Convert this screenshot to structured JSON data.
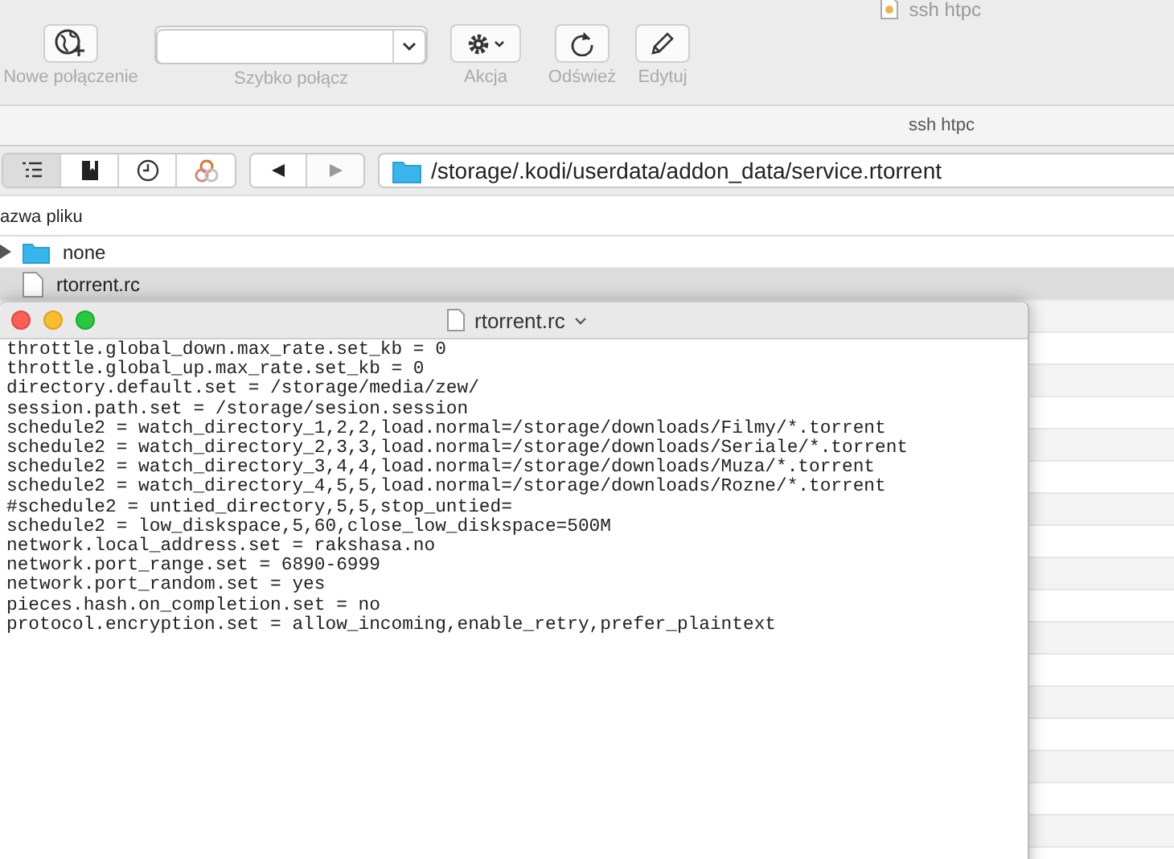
{
  "window": {
    "title": "ssh htpc"
  },
  "toolbar": [
    {
      "kind": "globe",
      "label": "Nowe połączenie"
    },
    {
      "kind": "combo",
      "label": "Szybko połącz"
    },
    {
      "kind": "gear",
      "label": "Akcja"
    },
    {
      "kind": "refresh",
      "label": "Odśwież"
    },
    {
      "kind": "pencil",
      "label": "Edytuj"
    }
  ],
  "connection_bar": {
    "title": "ssh htpc"
  },
  "view_tabs": [
    {
      "kind": "list",
      "selected": true
    },
    {
      "kind": "bookmarks",
      "selected": false
    },
    {
      "kind": "history",
      "selected": false
    },
    {
      "kind": "bonjour",
      "selected": false
    }
  ],
  "navigation": [
    {
      "kind": "back",
      "disabled": false
    },
    {
      "kind": "forward",
      "disabled": true
    }
  ],
  "path": "/storage/.kodi/userdata/addon_data/service.rtorrent",
  "file_list": {
    "column": "azwa pliku",
    "files": [
      {
        "kind": "folder",
        "name": "none",
        "selected": false,
        "expanded": false
      },
      {
        "kind": "file",
        "name": "rtorrent.rc",
        "selected": true
      }
    ]
  },
  "editor": {
    "title": "rtorrent.rc",
    "lines": [
      "throttle.global_down.max_rate.set_kb = 0",
      "throttle.global_up.max_rate.set_kb = 0",
      "directory.default.set = /storage/media/zew/",
      "session.path.set = /storage/sesion.session",
      "schedule2 = watch_directory_1,2,2,load.normal=/storage/downloads/Filmy/*.torrent",
      "schedule2 = watch_directory_2,3,3,load.normal=/storage/downloads/Seriale/*.torrent",
      "schedule2 = watch_directory_3,4,4,load.normal=/storage/downloads/Muza/*.torrent",
      "schedule2 = watch_directory_4,5,5,load.normal=/storage/downloads/Rozne/*.torrent",
      "#schedule2 = untied_directory,5,5,stop_untied=",
      "schedule2 = low_diskspace,5,60,close_low_diskspace=500M",
      "network.local_address.set = rakshasa.no",
      "network.port_range.set = 6890-6999",
      "network.port_random.set = yes",
      "pieces.hash.on_completion.set = no",
      "protocol.encryption.set = allow_incoming,enable_retry,prefer_plaintext"
    ]
  }
}
